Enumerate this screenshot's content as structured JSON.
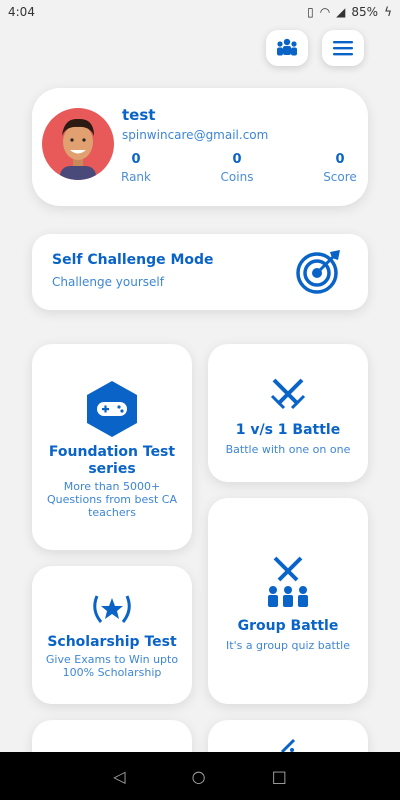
{
  "status": {
    "time": "4:04",
    "battery": "85%"
  },
  "profile": {
    "username": "test",
    "email": "spinwincare@gmail.com",
    "stats": [
      {
        "value": "0",
        "label": "Rank"
      },
      {
        "value": "0",
        "label": "Coins"
      },
      {
        "value": "0",
        "label": "Score"
      }
    ]
  },
  "challenge": {
    "title": "Self Challenge Mode",
    "subtitle": "Challenge yourself"
  },
  "tiles": {
    "foundation": {
      "title": "Foundation Test series",
      "subtitle": "More than 5000+ Questions from best CA teachers"
    },
    "battle": {
      "title": "1 v/s 1 Battle",
      "subtitle": "Battle with one on one"
    },
    "scholarship": {
      "title": "Scholarship Test",
      "subtitle": "Give Exams to Win upto 100% Scholarship"
    },
    "group": {
      "title": "Group Battle",
      "subtitle": "It's a group quiz battle"
    }
  },
  "icons": {
    "topbar_left": "group-icon",
    "topbar_right": "menu-icon",
    "challenge": "target-icon",
    "foundation": "gamepad-icon",
    "battle": "crossed-swords-icon",
    "scholarship": "star-laurel-icon",
    "group": "group-battle-icon"
  },
  "colors": {
    "accent": "#0a64c8",
    "avatar_bg": "#e85a5a",
    "background": "#f2f2f2"
  }
}
